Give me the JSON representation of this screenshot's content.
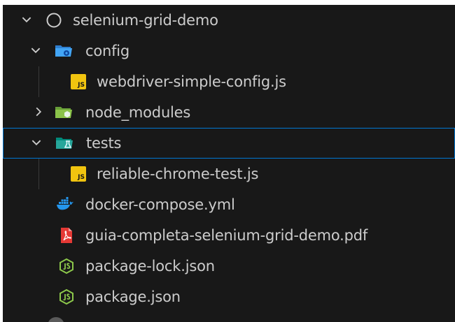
{
  "explorer": {
    "root": {
      "label": "selenium-grid-demo",
      "expanded": true,
      "icon": "circle-outline-icon"
    },
    "items": [
      {
        "label": "config",
        "type": "folder",
        "expanded": true,
        "icon": "folder-config-icon"
      },
      {
        "label": "webdriver-simple-config.js",
        "type": "file",
        "icon": "js-file-icon",
        "icon_text": "JS"
      },
      {
        "label": "node_modules",
        "type": "folder",
        "expanded": false,
        "icon": "folder-node-icon"
      },
      {
        "label": "tests",
        "type": "folder",
        "expanded": true,
        "selected": true,
        "icon": "folder-tests-icon"
      },
      {
        "label": "reliable-chrome-test.js",
        "type": "file",
        "icon": "js-file-icon",
        "icon_text": "JS"
      },
      {
        "label": "docker-compose.yml",
        "type": "file",
        "icon": "docker-icon"
      },
      {
        "label": "guia-completa-selenium-grid-demo.pdf",
        "type": "file",
        "icon": "pdf-icon"
      },
      {
        "label": "package-lock.json",
        "type": "file",
        "icon": "nodejs-icon"
      },
      {
        "label": "package.json",
        "type": "file",
        "icon": "nodejs-icon"
      }
    ]
  },
  "colors": {
    "background": "#181818",
    "text": "#cccccc",
    "selection_border": "#0078d4",
    "js_badge": "#f1c40f",
    "folder_config": "#42a5f5",
    "folder_node": "#8bc34a",
    "folder_tests": "#26a69a",
    "docker": "#2496ed",
    "pdf": "#e53935",
    "nodejs": "#8cc84b"
  }
}
